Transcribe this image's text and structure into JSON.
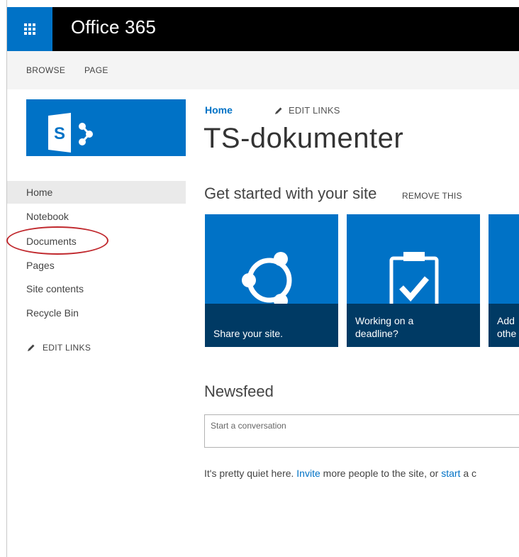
{
  "suite_bar": {
    "brand": "Office 365"
  },
  "ribbon": {
    "tabs": [
      "BROWSE",
      "PAGE"
    ]
  },
  "site_logo": {
    "letter": "S"
  },
  "quick_launch": {
    "items": [
      "Home",
      "Notebook",
      "Documents",
      "Pages",
      "Site contents",
      "Recycle Bin"
    ],
    "edit_links": "EDIT LINKS"
  },
  "breadcrumb": {
    "home": "Home",
    "edit_links": "EDIT LINKS"
  },
  "page_title": "TS-dokumenter",
  "get_started": {
    "title": "Get started with your site",
    "remove": "REMOVE THIS",
    "tiles": [
      {
        "line1": "Share your site.",
        "line2": ""
      },
      {
        "line1": "Working on a",
        "line2": "deadline?"
      },
      {
        "line1": "Add",
        "line2": "othe"
      }
    ]
  },
  "newsfeed": {
    "title": "Newsfeed",
    "placeholder": "Start a conversation",
    "message_before": "It's pretty quiet here. ",
    "invite_link": "Invite",
    "message_middle": " more people to the site, or ",
    "start_link": "start",
    "message_after": " a c"
  },
  "colors": {
    "accent": "#0072c6",
    "tile_caption": "#003a64",
    "suite_bar": "#000000",
    "annotation": "#c0282d"
  }
}
